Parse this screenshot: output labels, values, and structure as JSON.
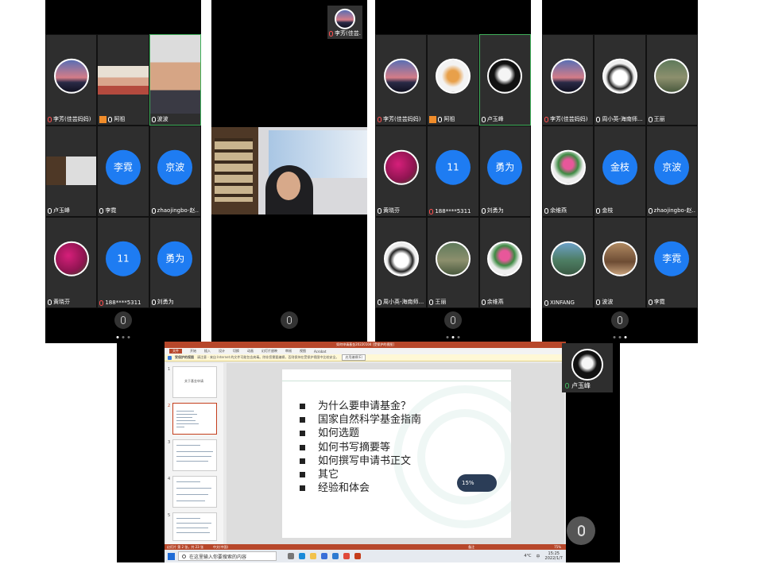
{
  "phones": [
    {
      "tiles": [
        {
          "name": "李芳(佳芸妈妈)",
          "type": "avatar",
          "img": "sunset",
          "mic": "red"
        },
        {
          "name": "阿祖",
          "type": "photo",
          "img": "woman",
          "mic": "white",
          "orange": true
        },
        {
          "name": "波波",
          "type": "photo",
          "img": "man",
          "mic": "white",
          "active": true
        },
        {
          "name": "卢玉峰",
          "type": "photo",
          "img": "office",
          "mic": "white"
        },
        {
          "name": "李霓",
          "type": "circle",
          "label": "李霓",
          "mic": "white"
        },
        {
          "name": "zhaojingbo-赵...",
          "type": "circle",
          "label": "京波",
          "mic": "white"
        },
        {
          "name": "黄晓芬",
          "type": "avatar",
          "img": "flower",
          "mic": "white"
        },
        {
          "name": "188****5311",
          "type": "circle",
          "label": "11",
          "mic": "red"
        },
        {
          "name": "刘勇为",
          "type": "circle",
          "label": "勇为",
          "mic": "white"
        }
      ]
    },
    {
      "speaker": {
        "name": "李芳(佳芸..."
      }
    },
    {
      "tiles": [
        {
          "name": "李芳(佳芸妈妈)",
          "type": "avatar",
          "img": "sunset",
          "mic": "red"
        },
        {
          "name": "阿祖",
          "type": "avatar",
          "img": "teapot",
          "mic": "white",
          "orange": true
        },
        {
          "name": "卢玉峰",
          "type": "avatar",
          "img": "cat",
          "mic": "white",
          "active": true
        },
        {
          "name": "黄晓芬",
          "type": "avatar",
          "img": "flower",
          "mic": "white"
        },
        {
          "name": "188****5311",
          "type": "circle",
          "label": "11",
          "mic": "red"
        },
        {
          "name": "刘勇为",
          "type": "circle",
          "label": "勇为",
          "mic": "white"
        },
        {
          "name": "周小英-海南师...",
          "type": "avatar",
          "img": "anime",
          "mic": "white"
        },
        {
          "name": "王丽",
          "type": "avatar",
          "img": "statue",
          "mic": "white"
        },
        {
          "name": "余维燕",
          "type": "avatar",
          "img": "tulip",
          "mic": "white"
        }
      ]
    },
    {
      "tiles": [
        {
          "name": "李芳(佳芸妈妈)",
          "type": "avatar",
          "img": "sunset",
          "mic": "red"
        },
        {
          "name": "周小英-海南师...",
          "type": "avatar",
          "img": "anime",
          "mic": "white"
        },
        {
          "name": "王丽",
          "type": "avatar",
          "img": "statue",
          "mic": "white"
        },
        {
          "name": "余维燕",
          "type": "avatar",
          "img": "tulip",
          "mic": "white"
        },
        {
          "name": "金枝",
          "type": "circle",
          "label": "金枝",
          "mic": "white"
        },
        {
          "name": "zhaojingbo-赵...",
          "type": "circle",
          "label": "京波",
          "mic": "white"
        },
        {
          "name": "XINFANG",
          "type": "avatar",
          "img": "city",
          "mic": "white"
        },
        {
          "name": "波波",
          "type": "avatar",
          "img": "tower",
          "mic": "white"
        },
        {
          "name": "李霓",
          "type": "circle",
          "label": "李霓",
          "mic": "white"
        }
      ]
    }
  ],
  "desktop": {
    "title": "如何申请基金20220104 [受保护的视图]",
    "ribbon_tabs": [
      "文件",
      "开始",
      "插入",
      "设计",
      "切换",
      "动画",
      "幻灯片放映",
      "审阅",
      "视图",
      "Acrobat"
    ],
    "protected_label": "受保护的视图",
    "protected_msg": "请注意 - 来自 Internet 的文件可能包含病毒。除非您需要编辑，否则保持在受保护视图中比较安全。",
    "enable_edit": "启用编辑(E)",
    "thumb_nums": [
      "1",
      "2",
      "3",
      "4",
      "5"
    ],
    "thumb1_title": "关于基金申请",
    "bullets": [
      "为什么要申请基金？",
      "国家自然科学基金指南",
      "如何选题",
      "如何书写摘要等",
      "如何撰写申请书正文",
      "其它",
      "经验和体会"
    ],
    "progress_pct": "15",
    "status_left": "幻灯片 第 2 张，共 23 张",
    "status_lang": "中文(中国)",
    "status_notes": "备注",
    "zoom": "75%",
    "search_placeholder": "在这里输入你要搜索的内容",
    "weather": "4°C",
    "ime": "中",
    "time": "15:25",
    "date": "2022/1/7",
    "self_name": "卢玉峰"
  },
  "colors": {
    "circle_blue": "#1e7cf2",
    "ppt_red": "#b7472a",
    "active_border": "#3fae5a",
    "mute_red": "#ff5050"
  }
}
